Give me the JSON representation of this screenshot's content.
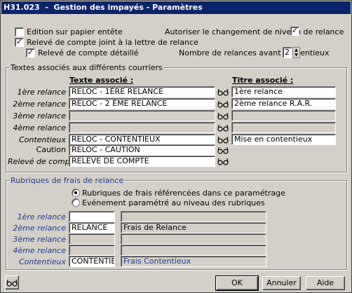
{
  "window": {
    "title": "H31.023  -  Gestion des impayés - Paramètres"
  },
  "options": {
    "edition_papier": {
      "label": "Edition sur papier entête",
      "checked": false
    },
    "releve_joint": {
      "label": "Relevé de compte joint à la lettre de relance",
      "checked": true
    },
    "releve_detaille": {
      "label": "Relevé de compte détaillé",
      "checked": true
    },
    "changement_niveau": {
      "label": "Autoriser le changement de niveau de relance",
      "checked": true
    },
    "nb_relances": {
      "label": "Nombre de relances avant contentieux",
      "value": "2"
    }
  },
  "textes": {
    "group_title": "Textes associés aux différents courriers",
    "col_texte": "Texte associé :",
    "col_titre": "Titre associé :",
    "rows": [
      {
        "label": "1ère relance",
        "texte": "RELOC  - 1ÈRE RELANCE",
        "titre": "1ère relance"
      },
      {
        "label": "2ème relance",
        "texte": "RELOC  - 2 ÈME RELANCE",
        "titre": "2ème relance R.A.R."
      },
      {
        "label": "3ème relance",
        "texte": "",
        "titre": ""
      },
      {
        "label": "4ème relance",
        "texte": "",
        "titre": ""
      },
      {
        "label": "Contentieux",
        "texte": "RELOC  - CONTENTIEUX",
        "titre": "Mise en contentieux"
      },
      {
        "label": "Caution",
        "texte": "RELOC - CAUTION"
      },
      {
        "label": "Relevé de compte",
        "texte": "RELEVE DE COMPTE"
      }
    ]
  },
  "rubriques": {
    "group_title": "Rubriques de frais de relance",
    "radio1": "Rubriques de frais référencées dans ce paramétrage",
    "radio2": "Evénement paramétré au niveau des rubriques",
    "rows": [
      {
        "label": "1ère relance",
        "code": "",
        "libelle": ""
      },
      {
        "label": "2ème relance",
        "code": "RELANCE",
        "libelle": "Frais de Relance"
      },
      {
        "label": "3ème relance",
        "code": "",
        "libelle": ""
      },
      {
        "label": "4ème relance",
        "code": "",
        "libelle": ""
      },
      {
        "label": "Contentieux",
        "code": "CONTENTIEUX",
        "libelle": "Frais Contentieux"
      }
    ]
  },
  "buttons": {
    "ok": "OK",
    "annuler": "Annuler",
    "aide": "Aide"
  }
}
